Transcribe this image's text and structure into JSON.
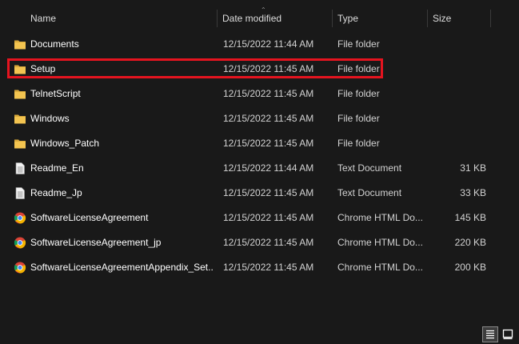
{
  "columns": {
    "name": "Name",
    "date_modified": "Date modified",
    "type": "Type",
    "size": "Size"
  },
  "files": [
    {
      "name": "Documents",
      "date": "12/15/2022 11:44 AM",
      "type": "File folder",
      "size": "",
      "icon": "folder-icon"
    },
    {
      "name": "Setup",
      "date": "12/15/2022 11:45 AM",
      "type": "File folder",
      "size": "",
      "icon": "folder-icon"
    },
    {
      "name": "TelnetScript",
      "date": "12/15/2022 11:45 AM",
      "type": "File folder",
      "size": "",
      "icon": "folder-icon"
    },
    {
      "name": "Windows",
      "date": "12/15/2022 11:45 AM",
      "type": "File folder",
      "size": "",
      "icon": "folder-icon"
    },
    {
      "name": "Windows_Patch",
      "date": "12/15/2022 11:45 AM",
      "type": "File folder",
      "size": "",
      "icon": "folder-icon"
    },
    {
      "name": "Readme_En",
      "date": "12/15/2022 11:44 AM",
      "type": "Text Document",
      "size": "31 KB",
      "icon": "text-document-icon"
    },
    {
      "name": "Readme_Jp",
      "date": "12/15/2022 11:45 AM",
      "type": "Text Document",
      "size": "33 KB",
      "icon": "text-document-icon"
    },
    {
      "name": "SoftwareLicenseAgreement",
      "date": "12/15/2022 11:45 AM",
      "type": "Chrome HTML Do...",
      "size": "145 KB",
      "icon": "chrome-icon"
    },
    {
      "name": "SoftwareLicenseAgreement_jp",
      "date": "12/15/2022 11:45 AM",
      "type": "Chrome HTML Do...",
      "size": "220 KB",
      "icon": "chrome-icon"
    },
    {
      "name": "SoftwareLicenseAgreementAppendix_Set...",
      "date": "12/15/2022 11:45 AM",
      "type": "Chrome HTML Do...",
      "size": "200 KB",
      "icon": "chrome-icon"
    }
  ],
  "colors": {
    "background": "#191919",
    "highlight": "#e5141f",
    "folder": "#f3c450"
  },
  "status_bar": {
    "details_view_icon": "details-view-icon",
    "large_icons_view_icon": "large-icons-view-icon"
  }
}
